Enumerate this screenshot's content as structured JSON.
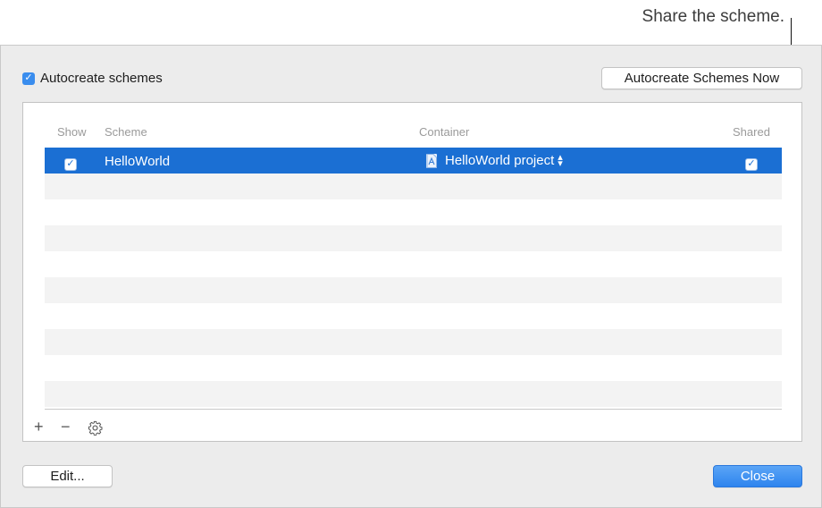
{
  "callout": {
    "text": "Share the scheme."
  },
  "autocreate": {
    "label": "Autocreate schemes",
    "checked": true
  },
  "buttons": {
    "autocreate_now": "Autocreate Schemes Now",
    "edit": "Edit...",
    "close": "Close"
  },
  "table": {
    "columns": {
      "show": "Show",
      "scheme": "Scheme",
      "container": "Container",
      "shared": "Shared"
    },
    "rows": [
      {
        "show": true,
        "scheme": "HelloWorld",
        "container": "HelloWorld project",
        "shared": true,
        "selected": true
      }
    ]
  },
  "toolbar": {
    "add": "+",
    "remove": "−",
    "settings": "gear-icon"
  },
  "colors": {
    "selection": "#1b6fd3",
    "accent": "#3a8dee"
  }
}
